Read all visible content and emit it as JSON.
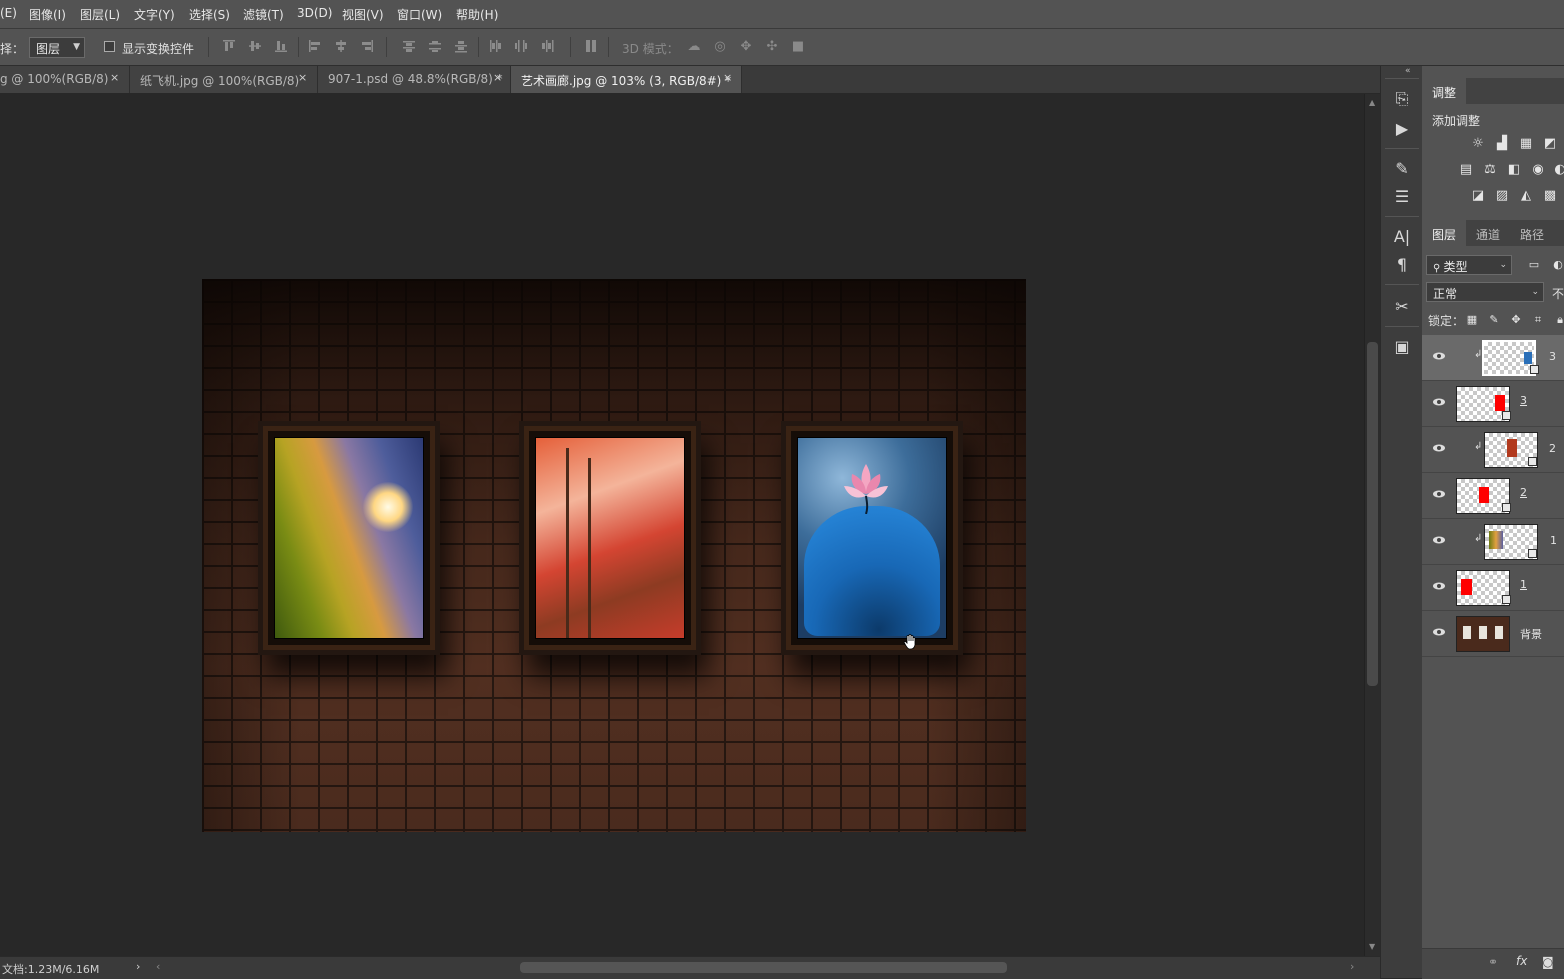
{
  "menu": [
    "(E)",
    "图像(I)",
    "图层(L)",
    "文字(Y)",
    "选择(S)",
    "滤镜(T)",
    "3D(D)",
    "视图(V)",
    "窗口(W)",
    "帮助(H)"
  ],
  "options": {
    "select_label": "择：",
    "select_value": "图层",
    "show_transform_label": "显示变换控件",
    "mode_3d_label": "3D 模式："
  },
  "tabs": [
    {
      "label": "g @ 100%(RGB/8)",
      "close": "×",
      "active": false
    },
    {
      "label": "纸飞机.jpg @ 100%(RGB/8)",
      "close": "×",
      "active": false
    },
    {
      "label": "907-1.psd @ 48.8%(RGB/8) *",
      "close": "×",
      "active": false
    },
    {
      "label": "艺术画廊.jpg @ 103% (3, RGB/8#) *",
      "close": "×",
      "active": true
    }
  ],
  "status": {
    "doc_size": "文档:1.23M/6.16M"
  },
  "adjustments": {
    "tab": "调整",
    "add_label": "添加调整",
    "icons": [
      "brightness-icon",
      "levels-icon",
      "curves-icon",
      "exposure-icon",
      "vibrance-icon",
      "color-balance-icon",
      "bw-icon",
      "photo-filter-icon",
      "channel-mixer-icon",
      "invert-icon",
      "posterize-icon",
      "threshold-icon",
      "gradient-map-icon"
    ]
  },
  "layers_panel": {
    "tabs": [
      "图层",
      "通道",
      "路径"
    ],
    "filter_value": "类型",
    "blend_mode": "正常",
    "opacity_label": "不",
    "lock_label": "锁定：",
    "layers": [
      {
        "name": "3",
        "type": "clipped-image",
        "selected": true
      },
      {
        "name": "3",
        "type": "shape",
        "selected": false
      },
      {
        "name": "2",
        "type": "clipped-image",
        "selected": false
      },
      {
        "name": "2",
        "type": "shape",
        "selected": false
      },
      {
        "name": "1",
        "type": "clipped-image",
        "selected": false
      },
      {
        "name": "1",
        "type": "shape",
        "selected": false
      },
      {
        "name": "背景",
        "type": "background",
        "selected": false
      }
    ]
  },
  "colors": {
    "accent_red": "#ff0000",
    "panel_bg": "#535353",
    "canvas_bg": "#282828"
  }
}
